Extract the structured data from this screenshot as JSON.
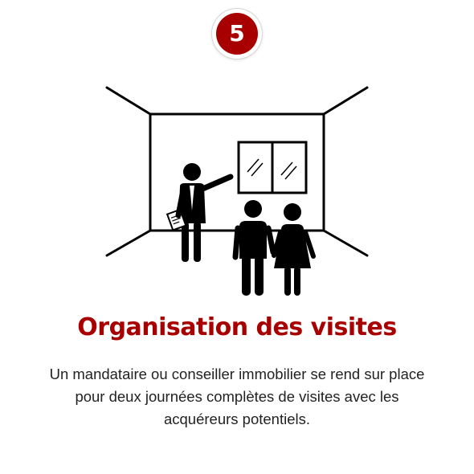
{
  "step": {
    "number": "5"
  },
  "illustration": {
    "icon": "property-visit-icon"
  },
  "title": "Organisation des visites",
  "description": "Un mandataire ou conseiller immobilier se rend sur place pour deux journées complètes de visites avec les acquéreurs potentiels.",
  "colors": {
    "accent": "#a80000",
    "ink": "#000000",
    "text": "#222222"
  }
}
